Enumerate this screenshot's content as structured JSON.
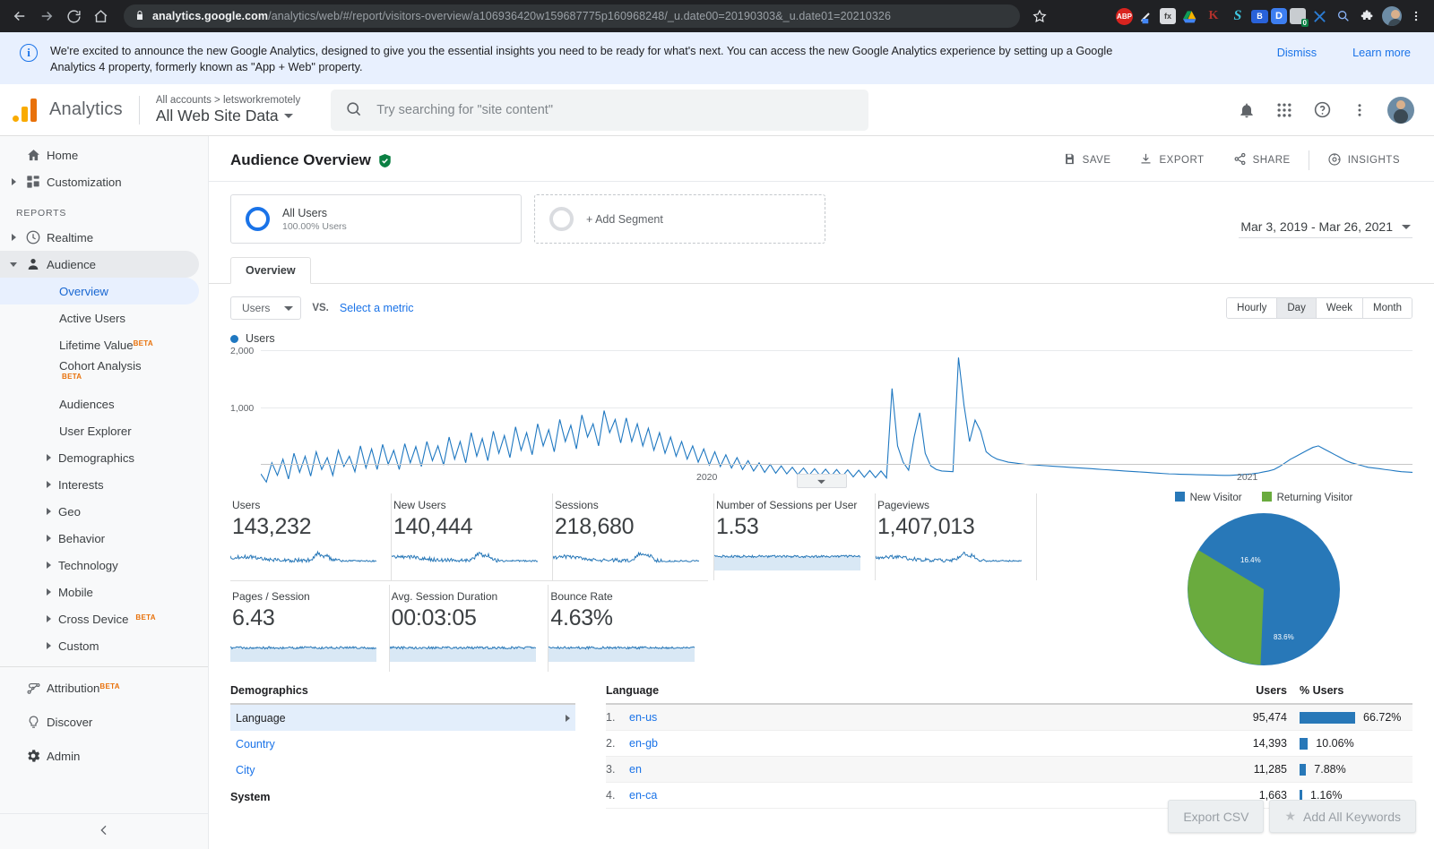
{
  "browser": {
    "url_bold": "analytics.google.com",
    "url_rest": "/analytics/web/#/report/visitors-overview/a106936420w159687775p160968248/_u.date00=20190303&_u.date01=20210326",
    "back_icon": "back-arrow-icon",
    "forward_icon": "forward-arrow-icon",
    "reload_icon": "reload-icon",
    "home_icon": "home-icon",
    "lock_icon": "lock-icon",
    "bookmark_icon": "star-icon",
    "extensions": [
      "ABP",
      "highlighter",
      "fx",
      "drive",
      "K",
      "S",
      "B",
      "D",
      "0",
      "tools",
      "search",
      "puzzle"
    ],
    "menu_icon": "kebab-menu-icon"
  },
  "banner": {
    "text": "We're excited to announce the new Google Analytics, designed to give you the essential insights you need to be ready for what's next. You can access the new Google Analytics experience by setting up a Google Analytics 4 property, formerly known as \"App + Web\" property.",
    "dismiss": "Dismiss",
    "learn_more": "Learn more"
  },
  "header": {
    "product": "Analytics",
    "breadcrumb": "All accounts > letsworkremotely",
    "property": "All Web Site Data",
    "search_placeholder": "Try searching for \"site content\"",
    "icons": [
      "bell-icon",
      "apps-grid-icon",
      "help-icon",
      "kebab-menu-icon",
      "avatar"
    ]
  },
  "sidebar": {
    "top": [
      {
        "label": "Home",
        "icon": "home-icon",
        "expandable": false
      },
      {
        "label": "Customization",
        "icon": "customization-icon",
        "expandable": true
      }
    ],
    "section_label": "REPORTS",
    "reports": [
      {
        "label": "Realtime",
        "icon": "clock-icon",
        "expandable": true
      },
      {
        "label": "Audience",
        "icon": "person-icon",
        "expandable": true,
        "selected": true
      }
    ],
    "audience_children": [
      {
        "label": "Overview",
        "active": true
      },
      {
        "label": "Active Users"
      },
      {
        "label": "Lifetime Value",
        "beta": "BETA"
      },
      {
        "label": "Cohort Analysis",
        "beta": "BETA",
        "beta_below": true
      },
      {
        "label": "Audiences"
      },
      {
        "label": "User Explorer"
      }
    ],
    "audience_expandables": [
      {
        "label": "Demographics"
      },
      {
        "label": "Interests"
      },
      {
        "label": "Geo"
      },
      {
        "label": "Behavior"
      },
      {
        "label": "Technology"
      },
      {
        "label": "Mobile"
      },
      {
        "label": "Cross Device",
        "beta": "BETA"
      },
      {
        "label": "Custom"
      }
    ],
    "bottom": [
      {
        "label": "Attribution",
        "icon": "attribution-icon",
        "beta": "BETA"
      },
      {
        "label": "Discover",
        "icon": "bulb-icon"
      },
      {
        "label": "Admin",
        "icon": "gear-icon"
      }
    ],
    "collapse_icon": "chevron-left-icon"
  },
  "report": {
    "title": "Audience Overview",
    "verified_icon": "shield-check-icon",
    "actions": [
      {
        "label": "SAVE",
        "icon": "save-icon"
      },
      {
        "label": "EXPORT",
        "icon": "download-icon"
      },
      {
        "label": "SHARE",
        "icon": "share-icon"
      },
      {
        "label": "INSIGHTS",
        "icon": "insights-icon"
      }
    ],
    "segments": [
      {
        "name": "All Users",
        "sub": "100.00% Users"
      },
      {
        "name": "+ Add Segment"
      }
    ],
    "date_range": "Mar 3, 2019 - Mar 26, 2021",
    "tab": "Overview",
    "metric_select": "Users",
    "vs_label": "VS.",
    "select_metric_link": "Select a metric",
    "granularity": [
      "Hourly",
      "Day",
      "Week",
      "Month"
    ],
    "granularity_active": "Day",
    "legend": "Users"
  },
  "chart_data": {
    "type": "line",
    "title": "Users",
    "xlabel": "",
    "ylabel": "Users",
    "ylim": [
      0,
      2000
    ],
    "yticks": [
      1000,
      2000
    ],
    "ytick_labels": [
      "1,000",
      "2,000"
    ],
    "xtick_labels": [
      "2020",
      "2021"
    ],
    "grid": true,
    "legend_position": "top-left",
    "series": [
      {
        "name": "Users",
        "color": "#1f78c1",
        "values": [
          320,
          210,
          470,
          300,
          520,
          250,
          600,
          340,
          560,
          290,
          620,
          380,
          540,
          300,
          640,
          420,
          560,
          350,
          700,
          400,
          660,
          380,
          720,
          450,
          640,
          380,
          730,
          470,
          690,
          420,
          760,
          500,
          700,
          440,
          820,
          520,
          760,
          470,
          880,
          560,
          800,
          500,
          900,
          600,
          840,
          540,
          960,
          640,
          880,
          580,
          1000,
          700,
          920,
          620,
          1060,
          760,
          980,
          660,
          1120,
          820,
          1000,
          700,
          1180,
          880,
          1060,
          740,
          1080,
          760,
          1000,
          700,
          940,
          640,
          880,
          600,
          820,
          560,
          760,
          520,
          700,
          480,
          660,
          440,
          620,
          420,
          580,
          400,
          540,
          380,
          500,
          360,
          470,
          340,
          450,
          330,
          430,
          320,
          410,
          310,
          400,
          300,
          390,
          295,
          385,
          290,
          380,
          285,
          375,
          280,
          370,
          275,
          365,
          270,
          360,
          265,
          1480,
          700,
          480,
          370,
          820,
          1150,
          600,
          430,
          380,
          360,
          355,
          350,
          1900,
          1250,
          760,
          1050,
          900,
          620,
          560,
          520,
          500,
          480,
          470,
          460,
          450,
          445,
          440,
          435,
          430,
          425,
          420,
          415,
          410,
          405,
          400,
          395,
          390,
          385,
          380,
          375,
          370,
          365,
          360,
          355,
          350,
          345,
          340,
          335,
          330,
          325,
          320,
          318,
          316,
          314,
          312,
          310,
          308,
          306,
          304,
          302,
          300,
          300,
          305,
          310,
          315,
          320,
          330,
          345,
          360,
          380,
          420,
          470,
          520,
          560,
          600,
          640,
          680,
          700,
          660,
          620,
          580,
          540,
          500,
          470,
          450,
          430,
          410,
          400,
          390,
          380,
          370,
          360,
          350,
          345,
          340
        ]
      }
    ]
  },
  "metrics_row1": [
    {
      "label": "Users",
      "value": "143,232",
      "filled": false
    },
    {
      "label": "New Users",
      "value": "140,444",
      "filled": false
    },
    {
      "label": "Sessions",
      "value": "218,680",
      "filled": false
    },
    {
      "label": "Number of Sessions per User",
      "value": "1.53",
      "filled": true
    },
    {
      "label": "Pageviews",
      "value": "1,407,013",
      "filled": false
    }
  ],
  "metrics_row2": [
    {
      "label": "Pages / Session",
      "value": "6.43",
      "filled": true
    },
    {
      "label": "Avg. Session Duration",
      "value": "00:03:05",
      "filled": true
    },
    {
      "label": "Bounce Rate",
      "value": "4.63%",
      "filled": true
    }
  ],
  "pie_chart": {
    "type": "pie",
    "title": "",
    "legend": [
      {
        "label": "New Visitor",
        "color": "#2878b8"
      },
      {
        "label": "Returning Visitor",
        "color": "#6aab3e"
      }
    ],
    "slices": [
      {
        "label": "New Visitor",
        "value": 83.6,
        "display": "83.6%",
        "color": "#2878b8"
      },
      {
        "label": "Returning Visitor",
        "value": 16.4,
        "display": "16.4%",
        "color": "#6aab3e"
      }
    ]
  },
  "demographics": {
    "header": "Demographics",
    "items": [
      {
        "label": "Language",
        "selected": true
      },
      {
        "label": "Country"
      },
      {
        "label": "City"
      }
    ],
    "section2": "System"
  },
  "language_table": {
    "columns": [
      "Language",
      "Users",
      "% Users"
    ],
    "rows": [
      {
        "index": "1.",
        "name": "en-us",
        "users": "95,474",
        "pct": "66.72%",
        "pct_value": 66.72
      },
      {
        "index": "2.",
        "name": "en-gb",
        "users": "14,393",
        "pct": "10.06%",
        "pct_value": 10.06
      },
      {
        "index": "3.",
        "name": "en",
        "users": "11,285",
        "pct": "7.88%",
        "pct_value": 7.88
      },
      {
        "index": "4.",
        "name": "en-ca",
        "users": "1,663",
        "pct": "1.16%",
        "pct_value": 1.16
      }
    ]
  },
  "overlay": {
    "export_csv": "Export CSV",
    "add_all_keywords": "Add All Keywords",
    "star_icon": "star-icon"
  }
}
